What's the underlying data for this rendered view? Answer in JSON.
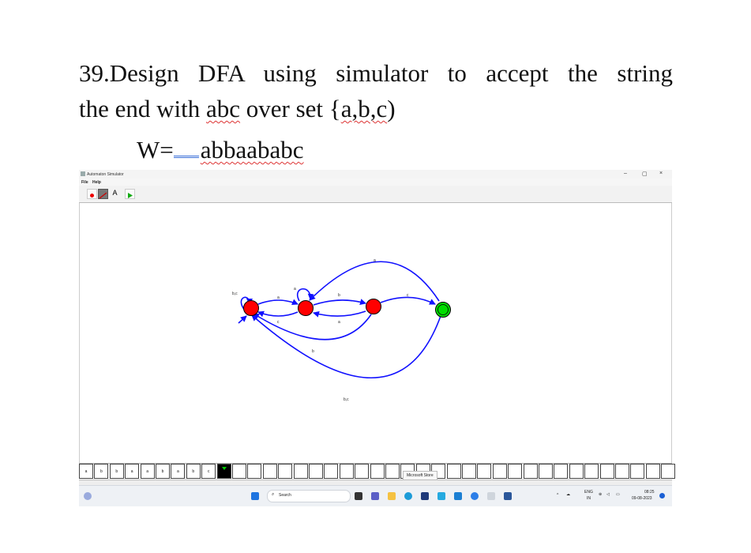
{
  "document": {
    "heading_line1": "39.Design DFA using simulator to accept the string",
    "heading_line2_a": "the end with ",
    "heading_line2_b": "abc",
    "heading_line2_c": " over set {",
    "heading_line2_d": "a,b,c",
    "heading_line2_e": ")",
    "w_prefix": "W=",
    "w_value": "abbaababc"
  },
  "window": {
    "title": "Automaton Simulator",
    "controls": {
      "minimize": "–",
      "maximize": "▢",
      "close": "×"
    }
  },
  "menu": {
    "file": "File",
    "help": "Help"
  },
  "toolbar": {
    "tools": [
      {
        "name": "state-tool",
        "icon": "red-dot-icon"
      },
      {
        "name": "transition-tool",
        "icon": "arrow-icon",
        "active": true
      },
      {
        "name": "label-tool",
        "icon": "text-A-icon",
        "label": "A"
      },
      {
        "name": "run-tool",
        "icon": "play-icon"
      }
    ]
  },
  "diagram": {
    "labels": {
      "q0_self": "b,c",
      "q0_q1": "a",
      "q1_self": "a",
      "q1_q0": "c",
      "q1_q2": "b",
      "q2_q1": "a",
      "q2_q3": "c",
      "q3_q1": "a",
      "q2_q0": "b",
      "q3_q0": "b,c"
    },
    "colors": {
      "normal_state": "#ff0000",
      "final_state": "#00dd00",
      "edge": "#1010ff"
    }
  },
  "tape": {
    "symbols": [
      "a",
      "b",
      "b",
      "a",
      "a",
      "b",
      "a",
      "b",
      "c"
    ],
    "blank_count": 29
  },
  "tooltip": "Microsoft Store",
  "taskbar": {
    "search_placeholder": "Search",
    "lang_top": "ENG",
    "lang_bottom": "IN",
    "time": "08:25",
    "date": "09-08-2023"
  }
}
